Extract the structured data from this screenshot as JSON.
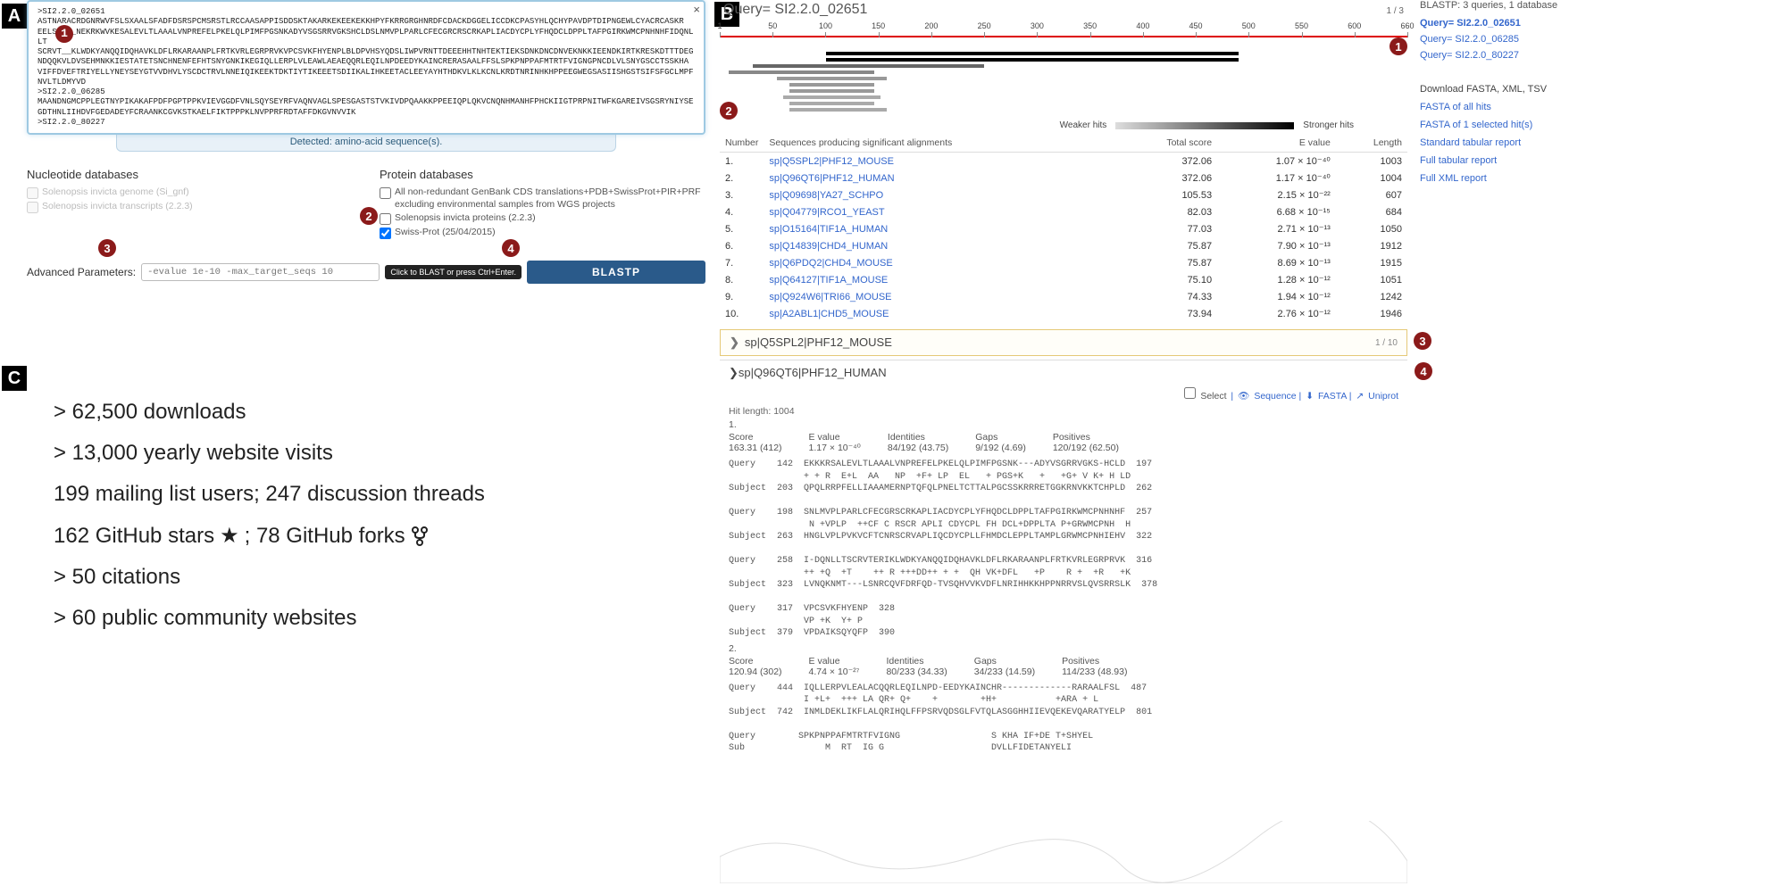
{
  "panelA": {
    "label": "A",
    "seq_text": ">SI2.2.0_02651\nASTNARACRDGNRWVFSLSXAALSFADFDSRSPCMSRSTLRCCAASAPPISDDSKTAKARKEKEEKEKKHPYFKRRGRGHNRDFCDACKDGGELICCDKCPASYHLQCHYPAVDPTDIPNGEWLCYACRCASKR\nEELS____NEKRKWVKESALEVLTLAAALVNPREFELPKELQLPIMFPGSNKADYVSGSRRVGKSHCLDSLNMVPLPARLCFECGRCRSCRKAPLIACDYCPLYFHQDCLDPPLTAFPGIRKWMCPNHNHFIDQNLLT\nSCRVT__KLWDKYANQQIDQHAVKLDFLRKARAANPLFRTKVRLEGRPRVKVPCSVKFHYENPLBLDPVHSYQDSLIWPVRNTTDEEEHHTNHTEKTIEKSDNKDNCDNVEKNKKIEENDKIRTKRESKDTTTDEG\nNDQQKVLDVSEHMNKKIESTATETSNCHNENFEFHTSNYGNKIKEGIQLLERPLVLEAWLAEAEQQRLEQILNPDEEDYKAINCRERASAALFFSLSPKPNPPAFMTRTFVIGNGPNCDLVLSNYGSCCTSSKHA\nVIFFDVEFTRIYELLYNEYSEYGTVVDHVLYSCDCTRVLNNEIQIKEEKTDKTIYTIKEEETSDIIKALIHKEETACLEEYAYHTHDKVLKLKCNLKRDTNRINHKHPPEEGWEGSASIISHGSTSIFSFGCLMPFNVLTLDMYVD\n>SI2.2.0_06285\nMAANDNGMCPPLEGTNYPIKAKAFPDFPGPTPPKVIEVGGDFVNLSQYSEYRFVAQNVAGLSPESGASTSTVKIVDPQAAKKPPEEIQPLQKVCNQNHMANHFPHCKIIGTPRPNITWFKGAREIVSGSRYNIYSE\nGDTHNLIIHDVFGEDADEYFCRAANKCGVKSTKAELFIKTPPPKLNVPPRFRDTAFFDKGVNVVIK\n>SI2.2.0_80227",
    "close": "×",
    "detected": "Detected: amino-acid sequence(s).",
    "nuc_head": "Nucleotide databases",
    "nuc_items": [
      "Solenopsis invicta genome (Si_gnf)",
      "Solenopsis invicta transcripts (2.2.3)"
    ],
    "prot_head": "Protein databases",
    "prot_items": [
      "All non-redundant GenBank CDS translations+PDB+SwissProt+PIR+PRF excluding environmental samples from WGS projects",
      "Solenopsis invicta proteins (2.2.3)",
      "Swiss-Prot (25/04/2015)"
    ],
    "adv_label": "Advanced Parameters:",
    "adv_value": "-evalue 1e-10 -max_target_seqs 10",
    "hint": "Click to BLAST or press Ctrl+Enter.",
    "btn": "BLASTP"
  },
  "panelB": {
    "label": "B",
    "title": "Query= SI2.2.0_02651",
    "qcount": "1 / 3",
    "ticks": [
      "1",
      "50",
      "100",
      "150",
      "200",
      "250",
      "300",
      "350",
      "400",
      "450",
      "500",
      "550",
      "600",
      "660"
    ],
    "weaker": "Weaker hits",
    "stronger": "Stronger hits",
    "cols": [
      "Number",
      "Sequences producing significant alignments",
      "Total score",
      "E value",
      "Length"
    ],
    "rows": [
      {
        "n": "1.",
        "seq": "sp|Q5SPL2|PHF12_MOUSE",
        "ts": "372.06",
        "ev": "1.07 × 10⁻⁴⁰",
        "len": "1003"
      },
      {
        "n": "2.",
        "seq": "sp|Q96QT6|PHF12_HUMAN",
        "ts": "372.06",
        "ev": "1.17 × 10⁻⁴⁰",
        "len": "1004"
      },
      {
        "n": "3.",
        "seq": "sp|Q09698|YA27_SCHPO",
        "ts": "105.53",
        "ev": "2.15 × 10⁻²²",
        "len": "607"
      },
      {
        "n": "4.",
        "seq": "sp|Q04779|RCO1_YEAST",
        "ts": "82.03",
        "ev": "6.68 × 10⁻¹⁵",
        "len": "684"
      },
      {
        "n": "5.",
        "seq": "sp|O15164|TIF1A_HUMAN",
        "ts": "77.03",
        "ev": "2.71 × 10⁻¹³",
        "len": "1050"
      },
      {
        "n": "6.",
        "seq": "sp|Q14839|CHD4_HUMAN",
        "ts": "75.87",
        "ev": "7.90 × 10⁻¹³",
        "len": "1912"
      },
      {
        "n": "7.",
        "seq": "sp|Q6PDQ2|CHD4_MOUSE",
        "ts": "75.87",
        "ev": "8.69 × 10⁻¹³",
        "len": "1915"
      },
      {
        "n": "8.",
        "seq": "sp|Q64127|TIF1A_MOUSE",
        "ts": "75.10",
        "ev": "1.28 × 10⁻¹²",
        "len": "1051"
      },
      {
        "n": "9.",
        "seq": "sp|Q924W6|TRI66_MOUSE",
        "ts": "74.33",
        "ev": "1.94 × 10⁻¹²",
        "len": "1242"
      },
      {
        "n": "10.",
        "seq": "sp|A2ABL1|CHD5_MOUSE",
        "ts": "73.94",
        "ev": "2.76 × 10⁻¹²",
        "len": "1946"
      }
    ],
    "hit_collapsed": "sp|Q5SPL2|PHF12_MOUSE",
    "hit_collapsed_cnt": "1 / 10",
    "hit_expanded": "sp|Q96QT6|PHF12_HUMAN",
    "tools": {
      "select": "Select",
      "seq": "Sequence",
      "fasta": "FASTA",
      "uni": "Uniprot"
    },
    "hitlen": "Hit length: 1004",
    "stats1": {
      "score_h": "Score",
      "score_v": "163.31 (412)",
      "ev_h": "E value",
      "ev_v": "1.17 × 10⁻⁴⁰",
      "id_h": "Identities",
      "id_v": "84/192 (43.75)",
      "gap_h": "Gaps",
      "gap_v": "9/192 (4.69)",
      "pos_h": "Positives",
      "pos_v": "120/192 (62.50)"
    },
    "aln1": "Query    142  EKKKRSALEVLTLAAALVNPREFELPKELQLPIMFPGSNK---ADYVSGRRVGKS-HCLD  197\n              + + R  E+L  AA   NP  +F+ LP  EL   + PGS+K   +   +G+ V K+ H LD\nSubject  203  QPQLRRPFELLIAAAMERNPTQFQLPNELTCTTALPGCSSKRRRETGGKRNVKKTCHPLD  262\n\nQuery    198  SNLMVPLPARLCFECGRSCRKAPLIACDYCPLYFHQDCLDPPLTAFPGIRKWMCPNHNHF  257\n               N +VPLP  ++CF C RSCR APLI CDYCPL FH DCL+DPPLTA P+GRWMCPNH  H\nSubject  263  HNGLVPLPVKVCFTCNRSCRVAPLIQCDYCPLLFHMDCLEPPLTAMPLGRWMCPNHIEHV  322\n\nQuery    258  I-DQNLLTSCRVTERIKLWDKYANQQIDQHAVKLDFLRKARAANPLFRTKVRLEGRPRVK  316\n              ++ +Q  +T    ++ R +++DD++ + +  QH VK+DFL   +P    R +  +R   +K\nSubject  323  LVNQKNMT---LSNRCQVFDRFQD-TVSQHVVKVDFLNRIHHKKHPPNRRVSLQVSRRSLK  378\n\nQuery    317  VPCSVKFHYENP  328\n              VP +K  Y+ P\nSubject  379  VPDAIKSQYQFP  390",
    "stats2": {
      "score_h": "Score",
      "score_v": "120.94 (302)",
      "ev_h": "E value",
      "ev_v": "4.74 × 10⁻²⁷",
      "id_h": "Identities",
      "id_v": "80/233 (34.33)",
      "gap_h": "Gaps",
      "gap_v": "34/233 (14.59)",
      "pos_h": "Positives",
      "pos_v": "114/233 (48.93)"
    },
    "aln2": "Query    444  IQLLERPVLEALACQQRLEQILNPD-EEDYKAINCHR-------------RARAALFSL  487\n              I +L+  +++ LA QR+ Q+    +        +H+           +ARA + L\nSubject  742  INMLDEKLIKFLALQRIHQLFFPSRVQDSGLFVTQLASGGHHIIEVQEKEVQARATYELP  801\n\nQuery        SPKPNPPAFMTRTFVIGNG                 S KHA IF+DE T+SHYEL\nSub               M  RT  IG G                    DVLLFIDETANYELI",
    "scorelabel2": "2."
  },
  "sideB": {
    "top": "BLASTP: 3 queries, 1 database",
    "q1": "Query= SI2.2.0_02651",
    "q2": "Query= SI2.2.0_06285",
    "q3": "Query= SI2.2.0_80227",
    "dlhead": "Download FASTA, XML, TSV",
    "d1": "FASTA of all hits",
    "d2": "FASTA of 1 selected hit(s)",
    "d3": "Standard tabular report",
    "d4": "Full tabular report",
    "d5": "Full XML report"
  },
  "panelC": {
    "label": "C",
    "l1": "> 62,500 downloads",
    "l2": "> 13,000 yearly website visits",
    "l3": "199 mailing list users; 247 discussion threads",
    "l4a": "162 GitHub stars",
    "l4b": "; 78 GitHub forks",
    "l5": "> 50 citations",
    "l6": "> 60 public community websites"
  }
}
